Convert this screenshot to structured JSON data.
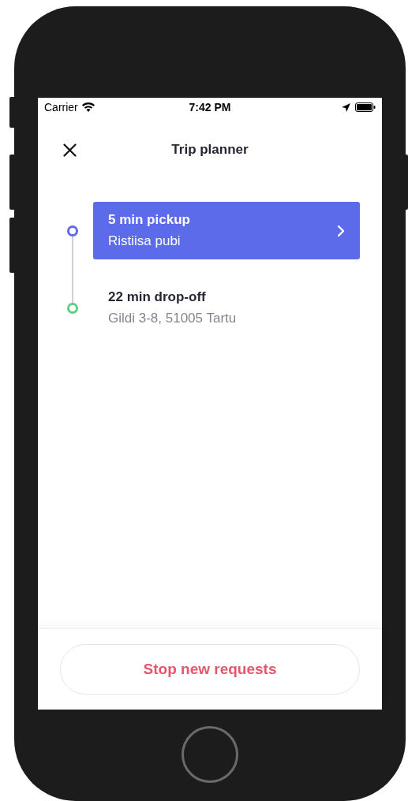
{
  "status_bar": {
    "carrier": "Carrier",
    "time": "7:42 PM"
  },
  "header": {
    "title": "Trip planner"
  },
  "stops": [
    {
      "title": "5 min pickup",
      "address": "Ristiisa pubi",
      "color": "#5b6bea",
      "selected": true
    },
    {
      "title": "22 min drop-off",
      "address": "Gildi 3-8, 51005 Tartu",
      "color": "#5fcf86",
      "selected": false
    }
  ],
  "footer": {
    "button": "Stop new requests"
  }
}
